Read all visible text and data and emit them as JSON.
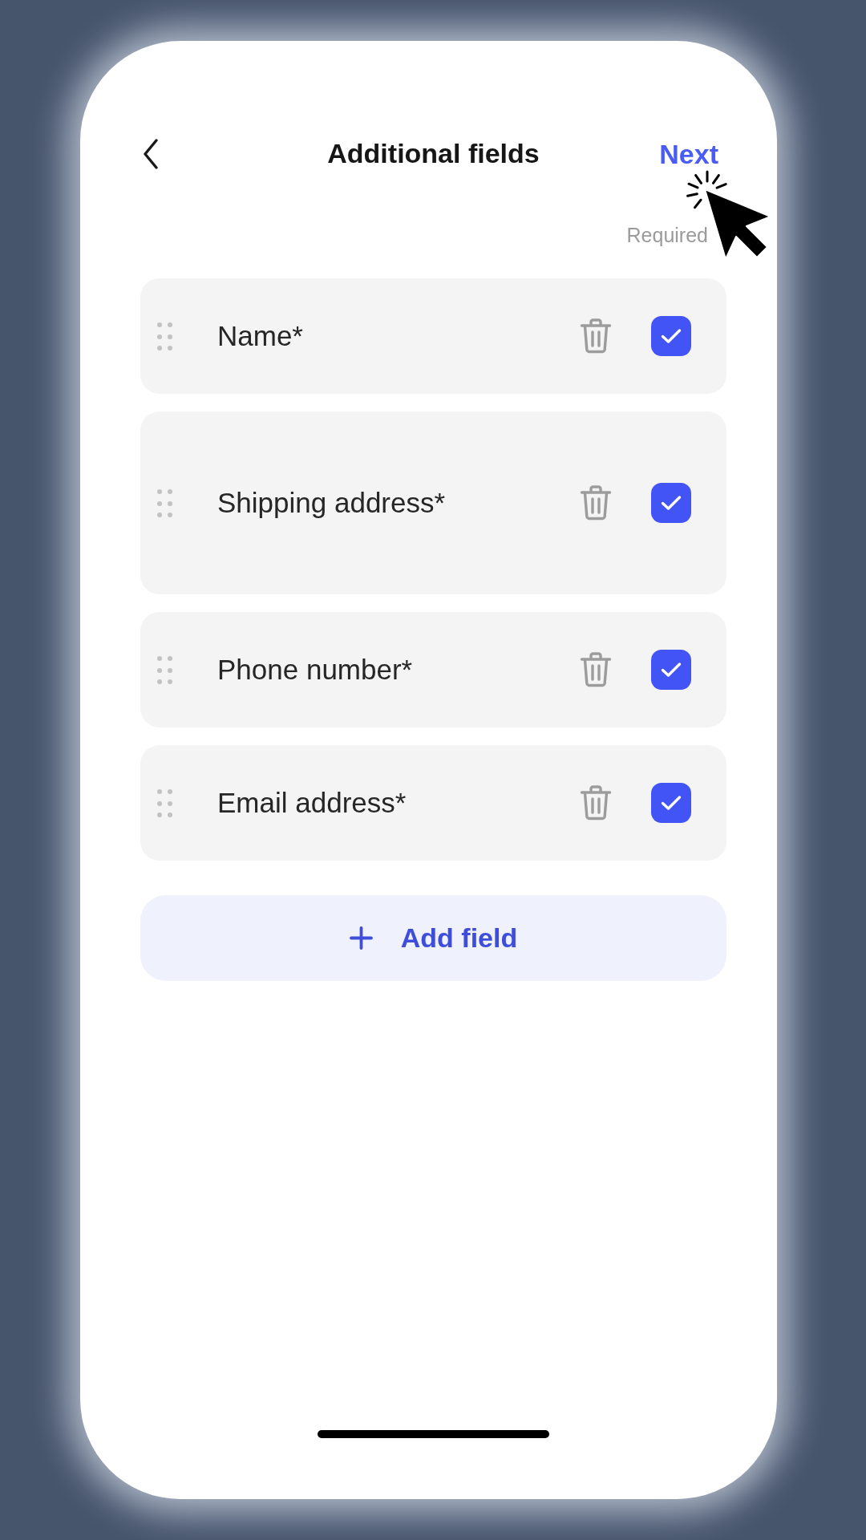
{
  "header": {
    "title": "Additional fields",
    "next_button": "Next"
  },
  "required_label": "Required",
  "fields": [
    {
      "label": "Name*",
      "kind": "single_line",
      "checked": true
    },
    {
      "label": "Shipping address*",
      "kind": "multi_line",
      "checked": true
    },
    {
      "label": "Phone number*",
      "kind": "single_line",
      "checked": true
    },
    {
      "label": "Email address*",
      "kind": "single_line",
      "checked": true
    }
  ],
  "add_button": {
    "label": "Add field"
  }
}
